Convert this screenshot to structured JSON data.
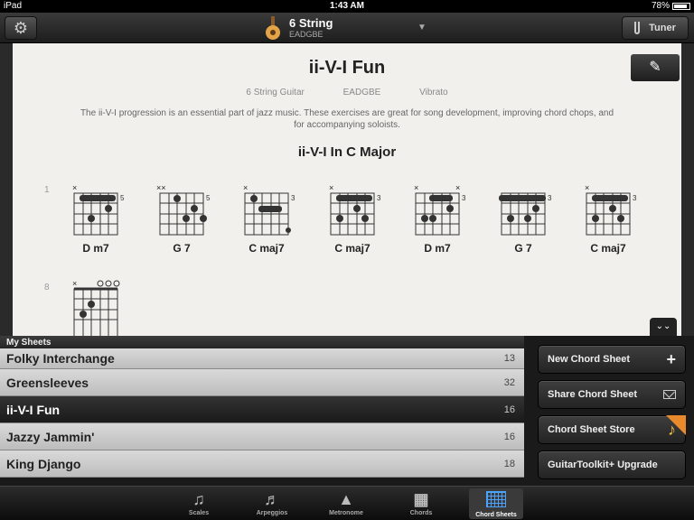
{
  "status": {
    "device": "iPad",
    "time": "1:43 AM",
    "battery": "78%",
    "battery_level": 0.78
  },
  "nav": {
    "instrument_name": "6 String",
    "instrument_tuning": "EADGBE",
    "tuner_label": "Tuner"
  },
  "sheet": {
    "title": "ii-V-I Fun",
    "meta": [
      "6 String Guitar",
      "EADGBE",
      "Vibrato"
    ],
    "description": "The ii-V-I progression is an essential part of jazz music. These exercises are great for song development, improving chord chops, and for accompanying soloists.",
    "subtitle": "ii-V-I In C Major",
    "rows": [
      {
        "number": "1",
        "chords": [
          {
            "name": "D m7",
            "fret": "5"
          },
          {
            "name": "G 7",
            "fret": "5"
          },
          {
            "name": "C maj7",
            "fret": "3"
          },
          {
            "name": "C maj7",
            "fret": "3"
          },
          {
            "name": "D m7",
            "fret": "3"
          },
          {
            "name": "G 7",
            "fret": "3"
          },
          {
            "name": "C maj7",
            "fret": "3"
          }
        ]
      },
      {
        "number": "8",
        "chords": [
          {
            "name": "",
            "fret": ""
          }
        ]
      }
    ]
  },
  "my_sheets": {
    "header": "My Sheets",
    "items": [
      {
        "name": "Folky Interchange",
        "count": "13"
      },
      {
        "name": "Greensleeves",
        "count": "32"
      },
      {
        "name": "ii-V-I Fun",
        "count": "16",
        "selected": true
      },
      {
        "name": "Jazzy Jammin'",
        "count": "16"
      },
      {
        "name": "King Django",
        "count": "18"
      }
    ]
  },
  "actions": [
    {
      "label": "New Chord Sheet",
      "icon": "plus-icon"
    },
    {
      "label": "Share Chord Sheet",
      "icon": "envelope-icon"
    },
    {
      "label": "Chord Sheet Store",
      "icon": "music-note-icon"
    },
    {
      "label": "GuitarToolkit+ Upgrade",
      "icon": ""
    }
  ],
  "tabs": [
    {
      "label": "Scales",
      "icon": "music-note-icon"
    },
    {
      "label": "Arpeggios",
      "icon": "notes-icon"
    },
    {
      "label": "Metronome",
      "icon": "metronome-icon"
    },
    {
      "label": "Chords",
      "icon": "fretboard-icon"
    },
    {
      "label": "Chord Sheets",
      "icon": "grid-icon",
      "active": true
    }
  ]
}
